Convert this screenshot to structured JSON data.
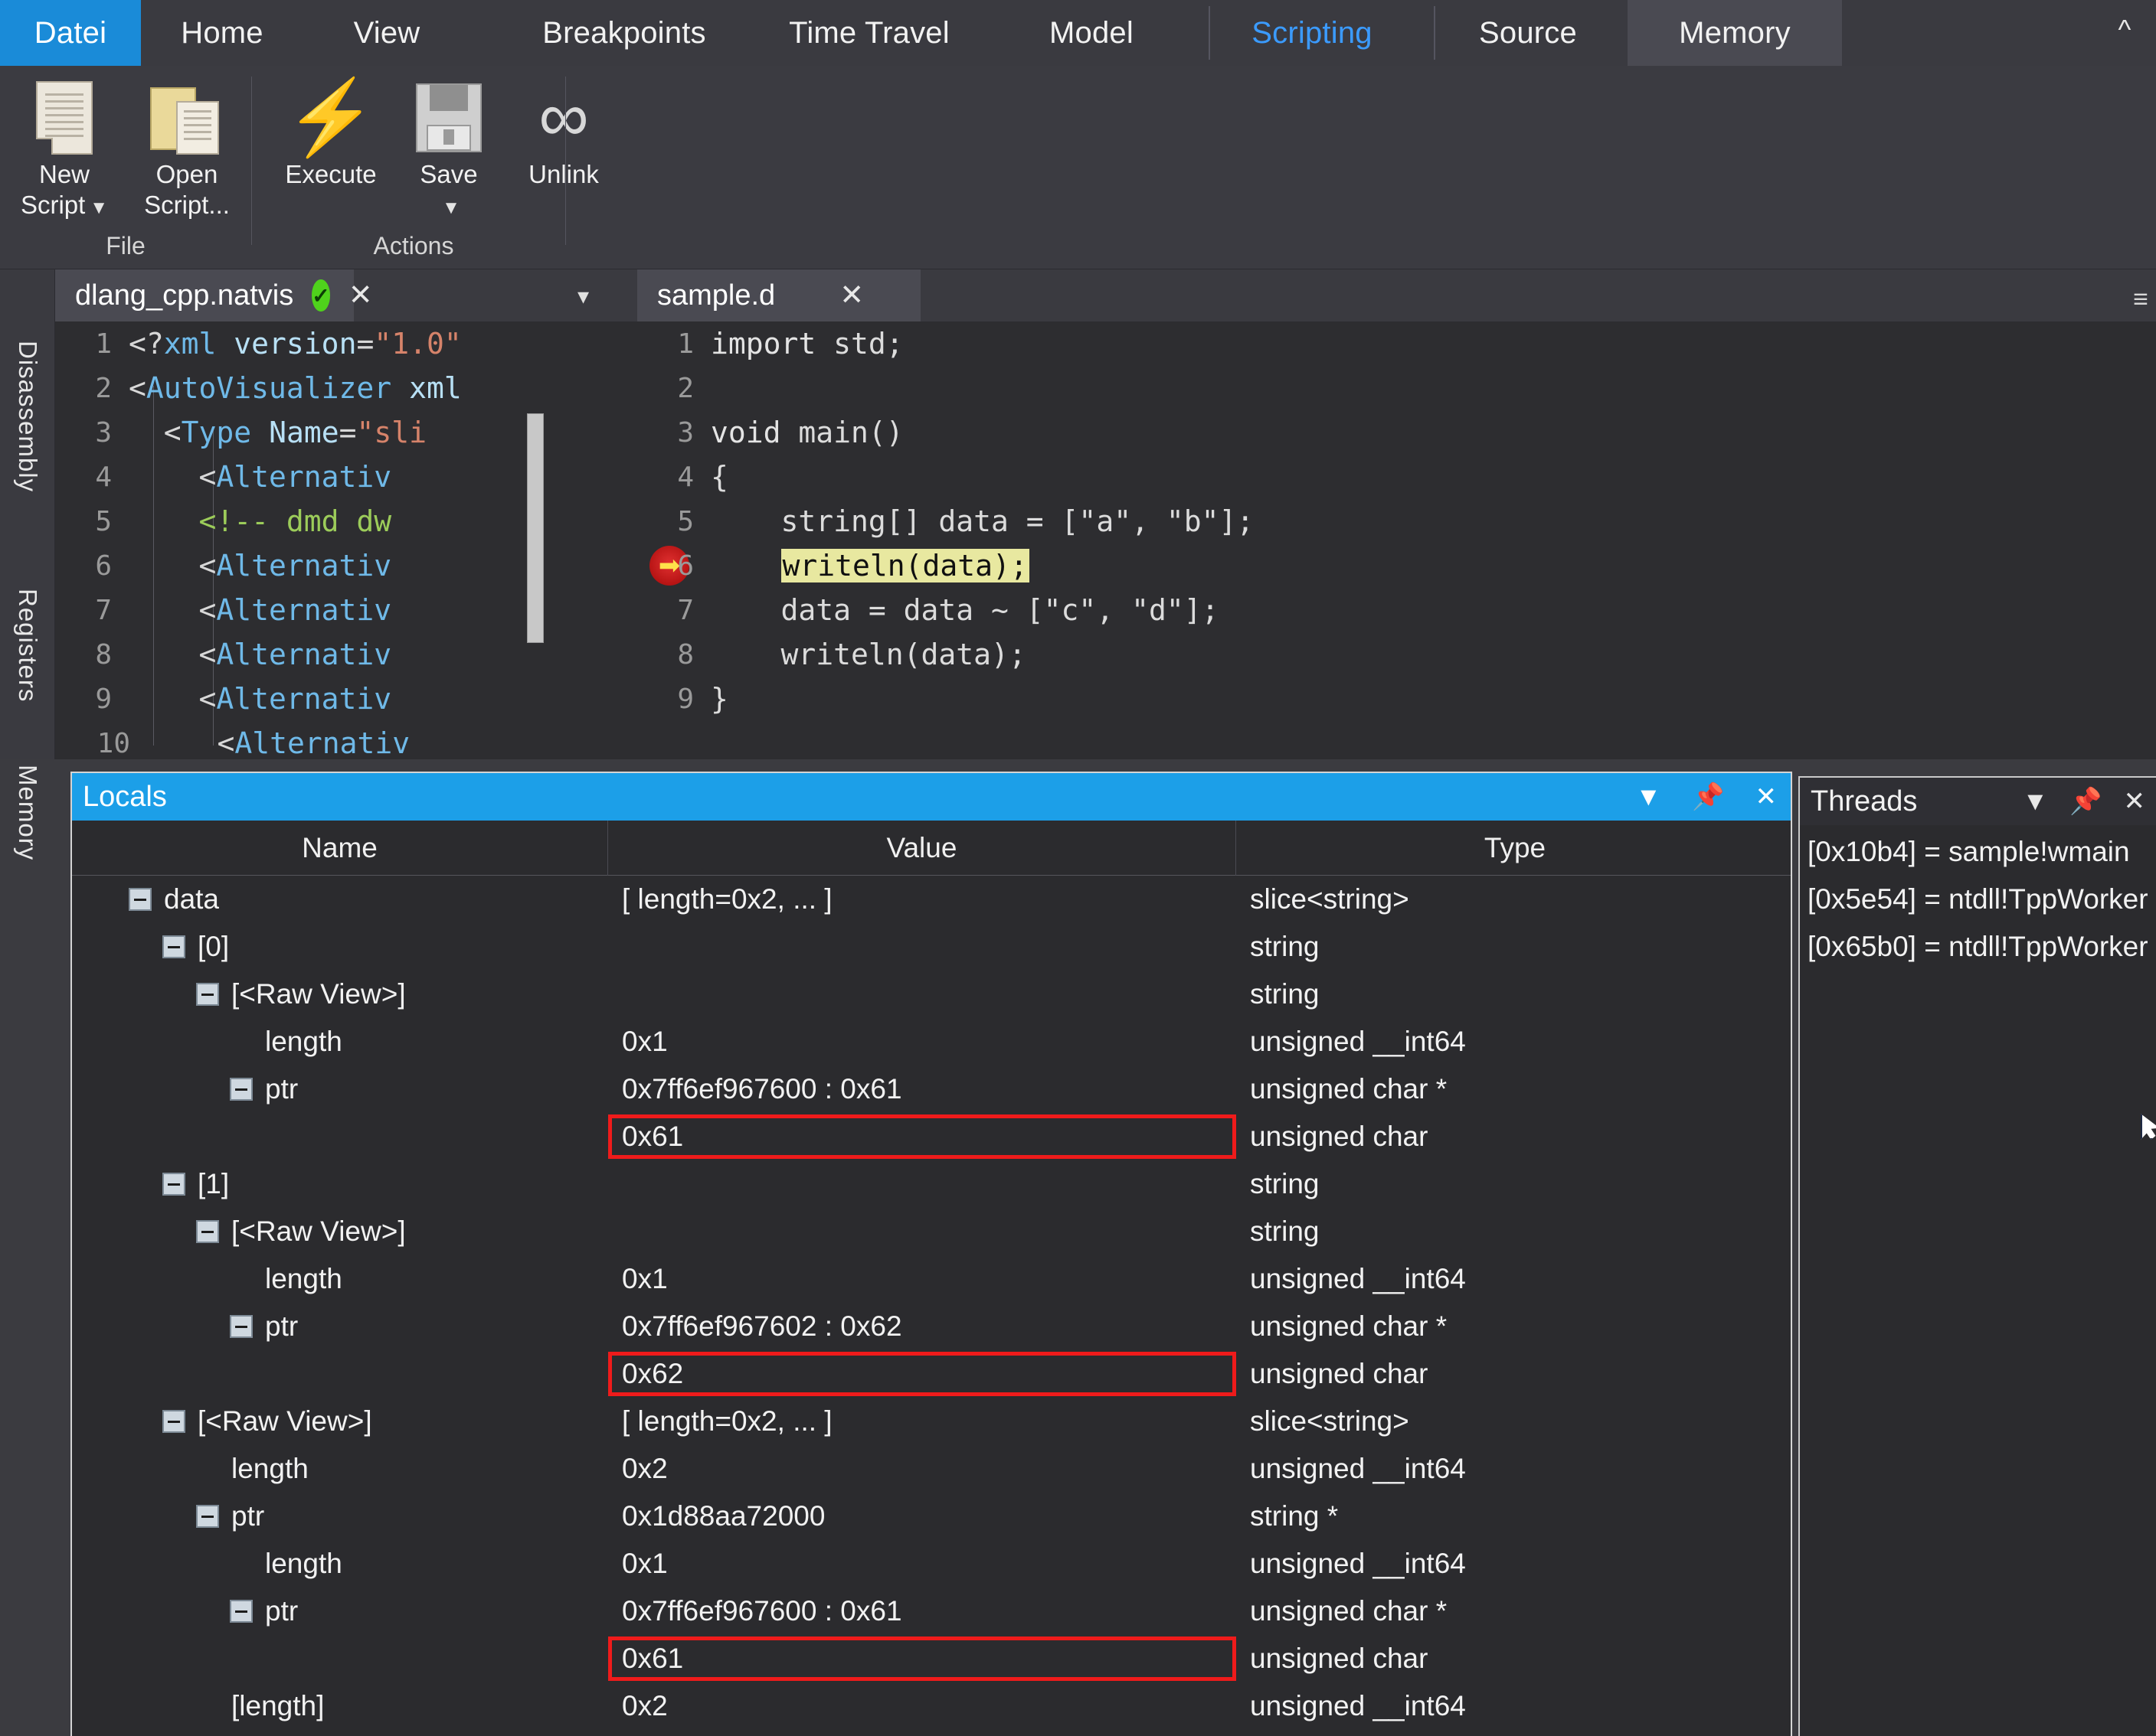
{
  "ribbon": {
    "tabs": [
      {
        "label": "Datei",
        "state": "selected"
      },
      {
        "label": "Home",
        "state": "normal"
      },
      {
        "label": "View",
        "state": "normal"
      },
      {
        "label": "Breakpoints",
        "state": "normal"
      },
      {
        "label": "Time Travel",
        "state": "normal"
      },
      {
        "label": "Model",
        "state": "normal"
      },
      {
        "label": "Scripting",
        "state": "active"
      },
      {
        "label": "Source",
        "state": "normal"
      },
      {
        "label": "Memory",
        "state": "hover"
      }
    ],
    "collapse_icon": "chevron-up-icon",
    "groups": [
      {
        "name": "File",
        "buttons": [
          {
            "line1": "New",
            "line2": "Script",
            "icon": "new-script-icon",
            "has_split": true
          },
          {
            "line1": "Open",
            "line2": "Script...",
            "icon": "open-script-icon",
            "has_split": false
          }
        ]
      },
      {
        "name": "Actions",
        "buttons": [
          {
            "line1": "Execute",
            "line2": "",
            "icon": "execute-bolt-icon",
            "has_split": false
          },
          {
            "line1": "Save",
            "line2": "",
            "icon": "save-disk-icon",
            "has_split": true
          },
          {
            "line1": "Unlink",
            "line2": "",
            "icon": "unlink-icon",
            "has_split": false
          }
        ]
      }
    ]
  },
  "left_dock": {
    "tabs": [
      {
        "label": "Disassembly",
        "icon": "disassembly-icon"
      },
      {
        "label": "Registers",
        "icon": "registers-icon"
      },
      {
        "label": "Memory",
        "icon": "memory-icon"
      }
    ]
  },
  "editor_left": {
    "tab": {
      "filename": "dlang_cpp.natvis",
      "status_icon": "valid-check-icon",
      "close_icon": "close-icon",
      "menu_icon": "tab-list-caret-icon"
    },
    "lines": [
      {
        "n": "1",
        "text": "<?xml version=\"1.0\""
      },
      {
        "n": "2",
        "text": "<AutoVisualizer xml"
      },
      {
        "n": "3",
        "text": "    <Type Name=\"sli"
      },
      {
        "n": "4",
        "text": "        <Alternativ"
      },
      {
        "n": "5",
        "text": "        <!-- dmd dw"
      },
      {
        "n": "6",
        "text": "        <Alternativ"
      },
      {
        "n": "7",
        "text": "        <Alternativ"
      },
      {
        "n": "8",
        "text": "        <Alternativ"
      },
      {
        "n": "9",
        "text": "        <Alternativ"
      },
      {
        "n": "10",
        "text": "        <Alternativ"
      }
    ]
  },
  "editor_right": {
    "tab": {
      "filename": "sample.d",
      "close_icon": "close-icon"
    },
    "lines": [
      {
        "n": "1",
        "text": "import std;"
      },
      {
        "n": "2",
        "text": ""
      },
      {
        "n": "3",
        "text": "void main()"
      },
      {
        "n": "4",
        "text": "{"
      },
      {
        "n": "5",
        "text": "    string[] data = [\"a\", \"b\"];"
      },
      {
        "n": "6",
        "text": "    writeln(data);",
        "highlighted": true,
        "breakpoint": true,
        "bp_icon": "breakpoint-current-statement-icon"
      },
      {
        "n": "7",
        "text": "    data = data ~ [\"c\", \"d\"];"
      },
      {
        "n": "8",
        "text": "    writeln(data);"
      },
      {
        "n": "9",
        "text": "}"
      }
    ]
  },
  "locals": {
    "title": "Locals",
    "title_buttons": [
      {
        "icon": "chevron-down-icon"
      },
      {
        "icon": "pin-icon"
      },
      {
        "icon": "close-icon"
      }
    ],
    "columns": [
      "Name",
      "Value",
      "Type"
    ],
    "rows": [
      {
        "indent": 0,
        "expander": true,
        "name": "data",
        "value": "[ length=0x2, ... ]",
        "type": "slice<string>",
        "boxed": false
      },
      {
        "indent": 1,
        "expander": true,
        "name": "[0]",
        "value": "",
        "type": "string",
        "boxed": false
      },
      {
        "indent": 2,
        "expander": true,
        "name": "[<Raw View>]",
        "value": "",
        "type": "string",
        "boxed": false
      },
      {
        "indent": 3,
        "expander": false,
        "name": "length",
        "value": "0x1",
        "type": "unsigned __int64",
        "boxed": false
      },
      {
        "indent": 3,
        "expander": true,
        "name": "ptr",
        "value": "0x7ff6ef967600 : 0x61",
        "type": "unsigned char *",
        "boxed": false
      },
      {
        "indent": 4,
        "expander": false,
        "name": "",
        "value": "0x61",
        "type": "unsigned char",
        "boxed": true
      },
      {
        "indent": 1,
        "expander": true,
        "name": "[1]",
        "value": "",
        "type": "string",
        "boxed": false
      },
      {
        "indent": 2,
        "expander": true,
        "name": "[<Raw View>]",
        "value": "",
        "type": "string",
        "boxed": false
      },
      {
        "indent": 3,
        "expander": false,
        "name": "length",
        "value": "0x1",
        "type": "unsigned __int64",
        "boxed": false
      },
      {
        "indent": 3,
        "expander": true,
        "name": "ptr",
        "value": "0x7ff6ef967602 : 0x62",
        "type": "unsigned char *",
        "boxed": false
      },
      {
        "indent": 4,
        "expander": false,
        "name": "",
        "value": "0x62",
        "type": "unsigned char",
        "boxed": true
      },
      {
        "indent": 1,
        "expander": true,
        "name": "[<Raw View>]",
        "value": "[ length=0x2, ... ]",
        "type": "slice<string>",
        "boxed": false
      },
      {
        "indent": 2,
        "expander": false,
        "name": "length",
        "value": "0x2",
        "type": "unsigned __int64",
        "boxed": false
      },
      {
        "indent": 2,
        "expander": true,
        "name": "ptr",
        "value": "0x1d88aa72000",
        "type": "string *",
        "boxed": false
      },
      {
        "indent": 3,
        "expander": false,
        "name": "length",
        "value": "0x1",
        "type": "unsigned __int64",
        "boxed": false
      },
      {
        "indent": 3,
        "expander": true,
        "name": "ptr",
        "value": "0x7ff6ef967600 : 0x61",
        "type": "unsigned char *",
        "boxed": false
      },
      {
        "indent": 4,
        "expander": false,
        "name": "",
        "value": "0x61",
        "type": "unsigned char",
        "boxed": true
      },
      {
        "indent": 2,
        "expander": false,
        "name": "[length]",
        "value": "0x2",
        "type": "unsigned __int64",
        "boxed": false
      }
    ]
  },
  "threads": {
    "title": "Threads",
    "title_buttons": [
      {
        "icon": "chevron-down-icon"
      },
      {
        "icon": "pin-icon"
      },
      {
        "icon": "close-icon"
      }
    ],
    "rows": [
      {
        "text": "[0x10b4] = sample!wmain"
      },
      {
        "text": "[0x5e54] = ntdll!TppWorker"
      },
      {
        "text": "[0x65b0] = ntdll!TppWorker"
      }
    ]
  },
  "colors": {
    "ribbon_file_tab": "#1a8bd8",
    "active_tab_text": "#3b9bff",
    "locals_title": "#1c9fe8",
    "highlight_statement": "#e8e8a0",
    "red_box": "#ef1b1b",
    "breakpoint": "#b71414",
    "valid_check": "#4fd21c"
  }
}
